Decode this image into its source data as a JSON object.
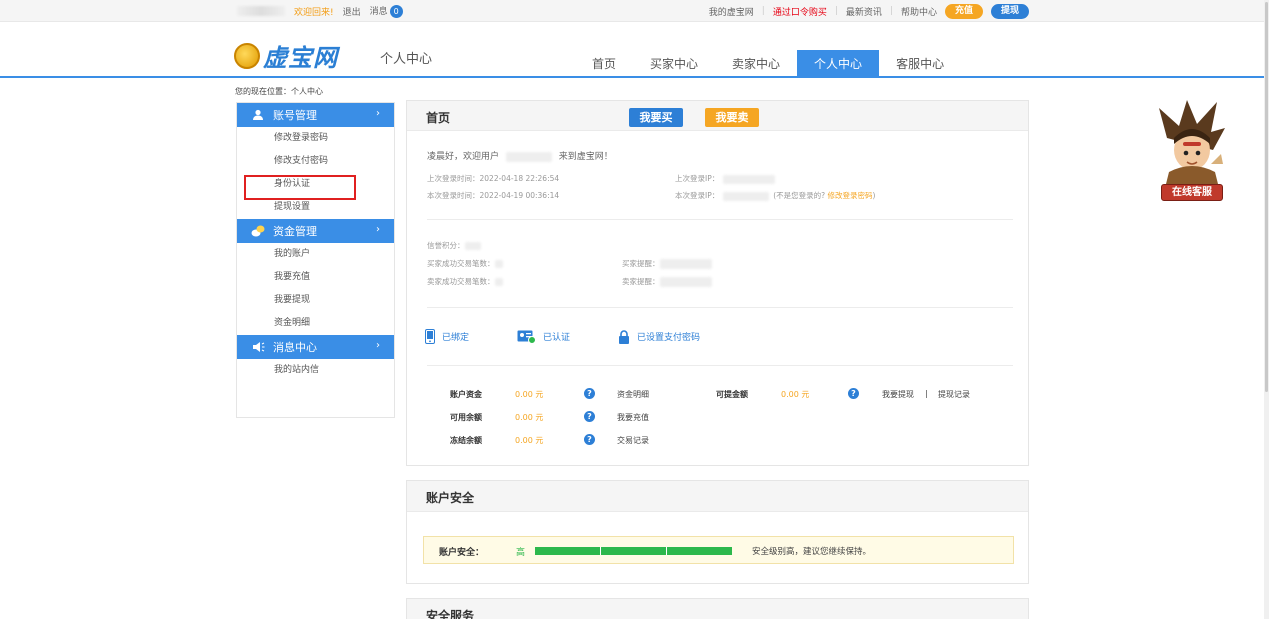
{
  "topbar": {
    "welcome": "欢迎回来!",
    "logout": "退出",
    "message": "消息",
    "message_count": "0",
    "links": [
      "我的虚宝网",
      "通过口令购买",
      "最新资讯",
      "帮助中心"
    ],
    "recharge": "充值",
    "withdraw": "提现"
  },
  "header": {
    "logo": "虚宝网",
    "subtitle": "个人中心",
    "nav": [
      "首页",
      "买家中心",
      "卖家中心",
      "个人中心",
      "客服中心"
    ],
    "active_nav": "个人中心"
  },
  "breadcrumb": "您的现在位置：个人中心",
  "sidebar": {
    "groups": [
      {
        "title": "账号管理",
        "items": [
          "修改登录密码",
          "修改支付密码",
          "身份认证",
          "提现设置"
        ]
      },
      {
        "title": "资金管理",
        "items": [
          "我的账户",
          "我要充值",
          "我要提现",
          "资金明细"
        ]
      },
      {
        "title": "消息中心",
        "items": [
          "我的站内信"
        ]
      }
    ]
  },
  "main": {
    "title": "首页",
    "buy_button": "我要买",
    "sell_button": "我要卖",
    "greeting_pre": "凌晨好，欢迎用户",
    "greeting_post": "来到虚宝网！",
    "last_login_time": "上次登录时间：2022-04-18 22:26:54",
    "this_login_time": "本次登录时间：2022-04-19 00:36:14",
    "last_login_ip": "上次登录IP：",
    "this_login_ip": "本次登录IP：",
    "not_me": "(不是您登录的?",
    "change_pwd": "修改登录密码",
    "close_paren": ")",
    "credit": "信誉积分：",
    "buyer_success": "买家成功交易笔数：",
    "seller_success": "卖家成功交易笔数：",
    "buyer_remind": "买家提醒：",
    "seller_remind": "卖家提醒：",
    "status": [
      "已绑定",
      "已认证",
      "已设置支付密码"
    ],
    "finance": {
      "rows": [
        {
          "label": "账户资金",
          "value": "0.00 元",
          "link": "资金明细"
        },
        {
          "label": "可用余额",
          "value": "0.00 元",
          "link": "我要充值"
        },
        {
          "label": "冻结余额",
          "value": "0.00 元",
          "link": "交易记录"
        }
      ],
      "withdrawable_label": "可提金额",
      "withdrawable_value": "0.00 元",
      "withdraw_link": "我要提现",
      "sep": "|",
      "withdraw_record": "提现记录"
    }
  },
  "security": {
    "title": "账户安全",
    "label": "账户安全：",
    "level": "高",
    "progress": 1.0,
    "tip": "安全级别高，建议您继续保持。"
  },
  "services": {
    "title": "安全服务"
  },
  "online_service": "在线客服",
  "colors": {
    "primary": "#3a8ee6",
    "accent": "#f5a623",
    "success": "#2db84c",
    "alert": "#e02020"
  }
}
